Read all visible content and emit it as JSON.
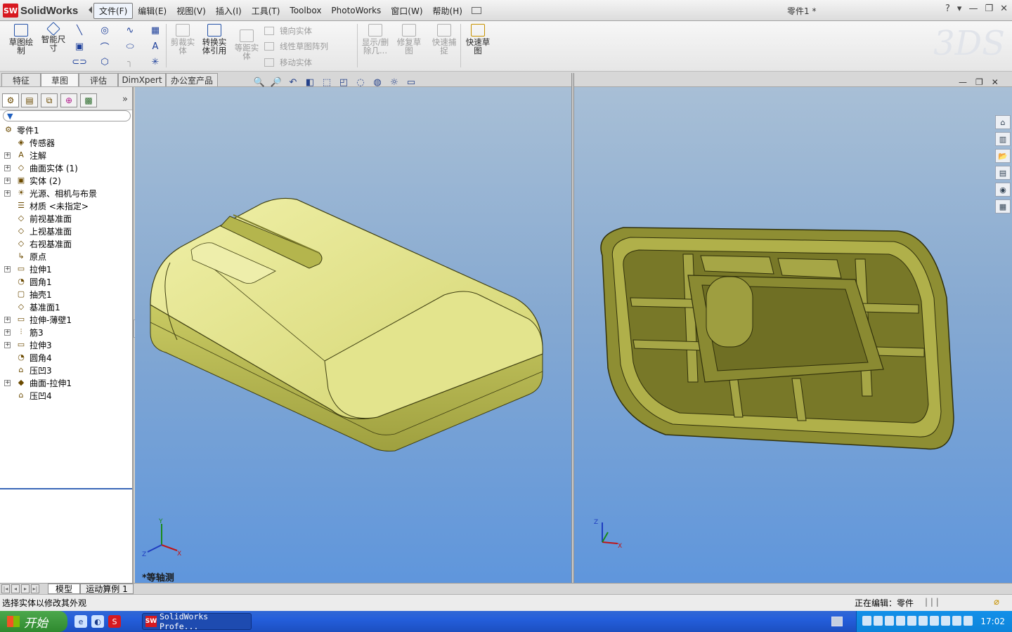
{
  "app": {
    "logo_badge": "SW",
    "name": "SolidWorks",
    "document_title": "零件1 *"
  },
  "menu": [
    "文件(F)",
    "编辑(E)",
    "视图(V)",
    "插入(I)",
    "工具(T)",
    "Toolbox",
    "PhotoWorks",
    "窗口(W)",
    "帮助(H)"
  ],
  "window_controls": [
    "?",
    "▾",
    "—",
    "❐",
    "✕"
  ],
  "commands": {
    "sketch": "草图绘制",
    "smart_dim": "智能尺寸",
    "trim": "剪裁实体",
    "convert": "转换实体引用",
    "offset": "等距实体",
    "mirror": "镜向实体",
    "linear_pattern": "线性草图阵列",
    "move": "移动实体",
    "display_delete": "显示/删除几...",
    "repair": "修复草图",
    "quick_snaps": "快速捕捉",
    "rapid_sketch": "快速草图"
  },
  "command_tabs": [
    "特征",
    "草图",
    "评估",
    "DimXpert",
    "办公室产品"
  ],
  "feature_tree": [
    {
      "label": "零件1",
      "icon": "part-icon",
      "root": true,
      "expandable": false
    },
    {
      "label": "传感器",
      "icon": "sensor-icon",
      "expandable": false
    },
    {
      "label": "注解",
      "icon": "annotation-icon",
      "expandable": true
    },
    {
      "label": "曲面实体 (1)",
      "icon": "surface-bodies-icon",
      "expandable": true
    },
    {
      "label": "实体 (2)",
      "icon": "solid-bodies-icon",
      "expandable": true
    },
    {
      "label": "光源、相机与布景",
      "icon": "lights-icon",
      "expandable": true
    },
    {
      "label": "材质 <未指定>",
      "icon": "material-icon",
      "expandable": false
    },
    {
      "label": "前视基准面",
      "icon": "plane-icon",
      "expandable": false
    },
    {
      "label": "上视基准面",
      "icon": "plane-icon",
      "expandable": false
    },
    {
      "label": "右视基准面",
      "icon": "plane-icon",
      "expandable": false
    },
    {
      "label": "原点",
      "icon": "origin-icon",
      "expandable": false
    },
    {
      "label": "拉伸1",
      "icon": "extrude-icon",
      "expandable": true
    },
    {
      "label": "圆角1",
      "icon": "fillet-icon",
      "expandable": false
    },
    {
      "label": "抽壳1",
      "icon": "shell-icon",
      "expandable": false
    },
    {
      "label": "基准面1",
      "icon": "plane-icon",
      "expandable": false
    },
    {
      "label": "拉伸-薄壁1",
      "icon": "extrude-icon",
      "expandable": true
    },
    {
      "label": "筋3",
      "icon": "rib-icon",
      "expandable": true
    },
    {
      "label": "拉伸3",
      "icon": "extrude-icon",
      "expandable": true
    },
    {
      "label": "圆角4",
      "icon": "fillet-icon",
      "expandable": false
    },
    {
      "label": "压凹3",
      "icon": "indent-icon",
      "expandable": false
    },
    {
      "label": "曲面-拉伸1",
      "icon": "surface-extrude-icon",
      "expandable": true
    },
    {
      "label": "压凹4",
      "icon": "indent-icon",
      "expandable": false
    }
  ],
  "viewport": {
    "view_label": "*等轴测",
    "triad_axes": [
      "Y",
      "X",
      "Z"
    ]
  },
  "bottom_tabs": [
    "模型",
    "运动算例 1"
  ],
  "status": {
    "message": "选择实体以修改其外观",
    "editing": "正在编辑：零件",
    "bars": "| | |"
  },
  "taskbar": {
    "start": "开始",
    "task_item": "SolidWorks Profe...",
    "clock": "17:02"
  },
  "colors": {
    "model_face": "#d6d77a",
    "model_dark": "#9b9b3f",
    "viewport_top": "#a8bfd6",
    "viewport_bottom": "#5f96dc",
    "accent": "#2452a8"
  }
}
